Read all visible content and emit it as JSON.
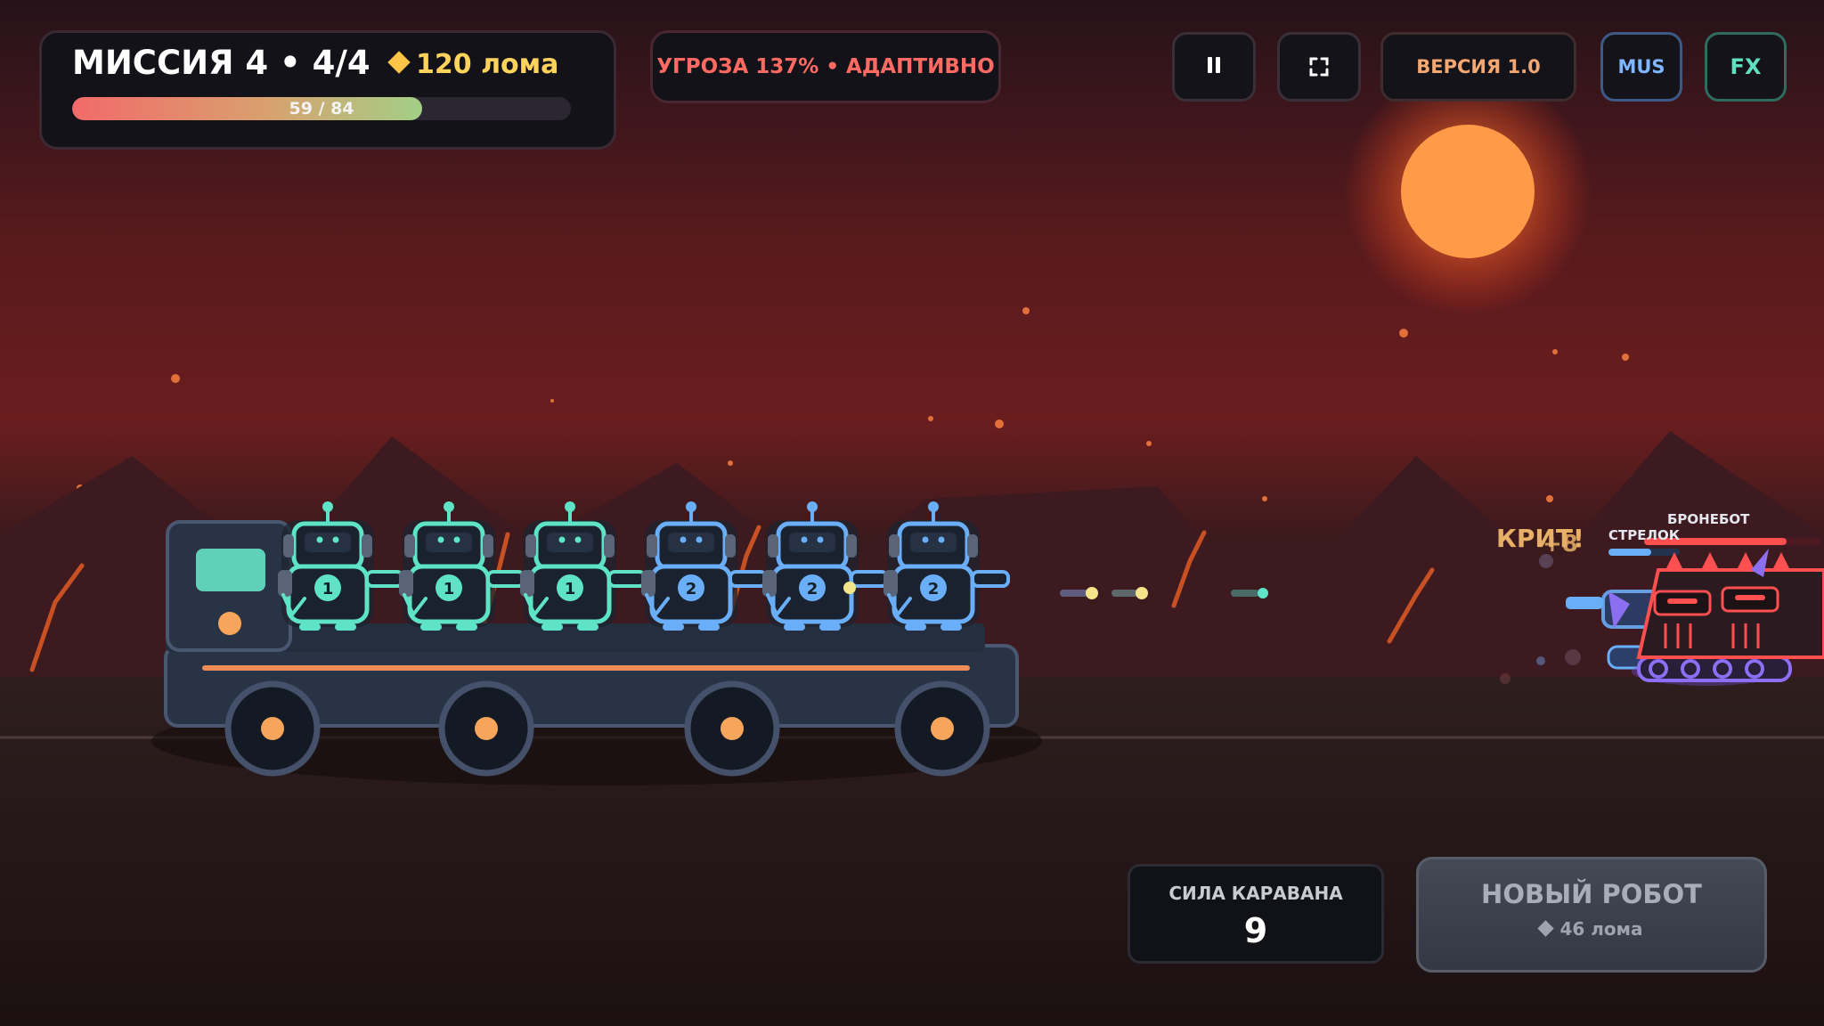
{
  "mission": {
    "title": "МИССИЯ 4 • 4/4",
    "scrap": "120 лома",
    "progress_text": "59 / 84",
    "progress_current": 59,
    "progress_total": 84
  },
  "threat": {
    "text": "УГРОЗА 137% • АДАПТИВНО"
  },
  "controls": {
    "pause_icon": "pause-icon",
    "fullscreen_icon": "fullscreen-icon",
    "version_label": "ВЕРСИЯ 1.0",
    "music_label": "MUS",
    "fx_label": "FX"
  },
  "caravan": {
    "power_label": "СИЛА КАРАВАНА",
    "power_value": "9",
    "robots": [
      {
        "level": "1",
        "color": "#5ee3c6"
      },
      {
        "level": "1",
        "color": "#5ee3c6"
      },
      {
        "level": "1",
        "color": "#5ee3c6"
      },
      {
        "level": "2",
        "color": "#6aaef7"
      },
      {
        "level": "2",
        "color": "#6aaef7"
      },
      {
        "level": "2",
        "color": "#6aaef7"
      }
    ]
  },
  "shop": {
    "new_robot_label": "НОВЫЙ РОБОТ",
    "new_robot_cost": "46 лома"
  },
  "combat": {
    "crit_text": "КРИТ!",
    "damage_text": "+8",
    "enemies": [
      {
        "name": "СТРЕЛОК",
        "health": 0.6,
        "color": "#6aaef7"
      },
      {
        "name": "БРОНЕБОТ",
        "health": 0.8,
        "color": "#ff4f4f"
      }
    ]
  },
  "colors": {
    "sun": "#ff9a48",
    "sky_top": "#2a1216",
    "sky_mid": "#6e1c1f",
    "ground": "#2a1c1d",
    "ally_teal": "#5ee3c6",
    "ally_blue": "#6aaef7",
    "enemy_red": "#ff4f4f",
    "scrap_gold": "#ffc548",
    "threat_red": "#ff6a63"
  }
}
